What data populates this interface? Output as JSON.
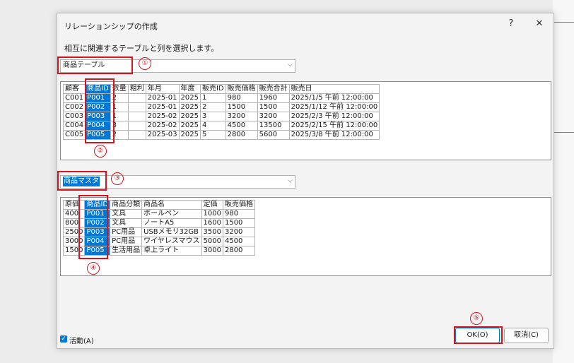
{
  "dialog": {
    "title": "リレーションシップの作成",
    "help": "?",
    "close": "✕",
    "instruction": "相互に関連するテーブルと列を選択します。"
  },
  "table1": {
    "selected": "商品テーブル",
    "columns": [
      "顧客",
      "商品ID",
      "数量",
      "粗利",
      "年月",
      "年度",
      "販売ID",
      "販売価格",
      "販売合計",
      "販売日"
    ],
    "rows": [
      [
        "C001",
        "P001",
        "2",
        "",
        "2025-01",
        "2025",
        "1",
        "980",
        "1960",
        "2025/1/5 午前 12:00:00"
      ],
      [
        "C002",
        "P002",
        "1",
        "",
        "2025-01",
        "2025",
        "2",
        "1500",
        "1500",
        "2025/1/12 午前 12:00:00"
      ],
      [
        "C003",
        "P003",
        "1",
        "",
        "2025-02",
        "2025",
        "3",
        "3200",
        "3200",
        "2025/2/3 午前 12:00:00"
      ],
      [
        "C004",
        "P004",
        "3",
        "",
        "2025-02",
        "2025",
        "4",
        "4500",
        "13500",
        "2025/2/15 午前 12:00:00"
      ],
      [
        "C005",
        "P005",
        "2",
        "",
        "2025-03",
        "2025",
        "5",
        "2800",
        "5600",
        "2025/3/8 午前 12:00:00"
      ]
    ]
  },
  "table2": {
    "selected": "商品マスタ",
    "columns": [
      "原価",
      "商品ID",
      "商品分類",
      "商品名",
      "定価",
      "販売価格"
    ],
    "rows": [
      [
        "400",
        "P001",
        "文具",
        "ボールペン",
        "1000",
        "980"
      ],
      [
        "800",
        "P002",
        "文具",
        "ノートA5",
        "1600",
        "1500"
      ],
      [
        "2500",
        "P003",
        "PC用品",
        "USBメモリ32GB",
        "3500",
        "3200"
      ],
      [
        "3000",
        "P004",
        "PC用品",
        "ワイヤレスマウス",
        "5000",
        "4500"
      ],
      [
        "1500",
        "P005",
        "生活用品",
        "卓上ライト",
        "3000",
        "2800"
      ]
    ]
  },
  "footer": {
    "active_label": "活動(A)",
    "ok_label": "OK(O)",
    "cancel_label": "取消(C)"
  },
  "annotations": [
    "①",
    "②",
    "③",
    "④",
    "⑤"
  ],
  "colors": {
    "highlight": "#0078d7",
    "annotation": "#d6141e"
  }
}
